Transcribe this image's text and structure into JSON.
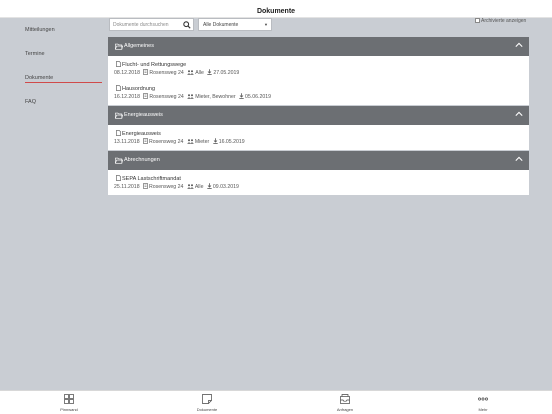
{
  "title": "Dokumente",
  "sidebar": {
    "items": [
      {
        "label": "Mitteilungen",
        "active": false
      },
      {
        "label": "Termine",
        "active": false
      },
      {
        "label": "Dokumente",
        "active": true
      },
      {
        "label": "FAQ",
        "active": false
      }
    ],
    "active_color": "#d04a4a"
  },
  "toolbar": {
    "search_placeholder": "Dokumente durchsuchen",
    "filter_value": "Alle Dokumente",
    "archive_label": "Archivierte anzeigen"
  },
  "groups": [
    {
      "name": "Allgemeines",
      "documents": [
        {
          "title": "Flucht- und Rettungswege",
          "date": "08.12.2018",
          "property": "Rosensweg 24",
          "audience": "Alle",
          "download_date": "27.05.2019"
        },
        {
          "title": "Hausordnung",
          "date": "16.12.2018",
          "property": "Rosensweg 24",
          "audience": "Mieter, Bewohner",
          "download_date": "05.06.2019"
        }
      ]
    },
    {
      "name": "Energieausweis",
      "documents": [
        {
          "title": "Energieausweis",
          "date": "13.11.2018",
          "property": "Rosensweg 24",
          "audience": "Mieter",
          "download_date": "16.05.2019"
        }
      ]
    },
    {
      "name": "Abrechnungen",
      "documents": [
        {
          "title": "SEPA Lastschriftmandat",
          "date": "25.11.2018",
          "property": "Rosensweg 24",
          "audience": "Alle",
          "download_date": "09.03.2019"
        }
      ]
    }
  ],
  "tabbar": {
    "items": [
      {
        "label": "Pinnwand",
        "icon": "grid-icon"
      },
      {
        "label": "Dokumente",
        "icon": "document-icon"
      },
      {
        "label": "Anfragen",
        "icon": "inbox-icon"
      },
      {
        "label": "Mehr",
        "icon": "more-icon"
      }
    ]
  },
  "colors": {
    "background": "#c9cdd3",
    "group_header": "#6c6f73",
    "accent": "#d04a4a"
  }
}
